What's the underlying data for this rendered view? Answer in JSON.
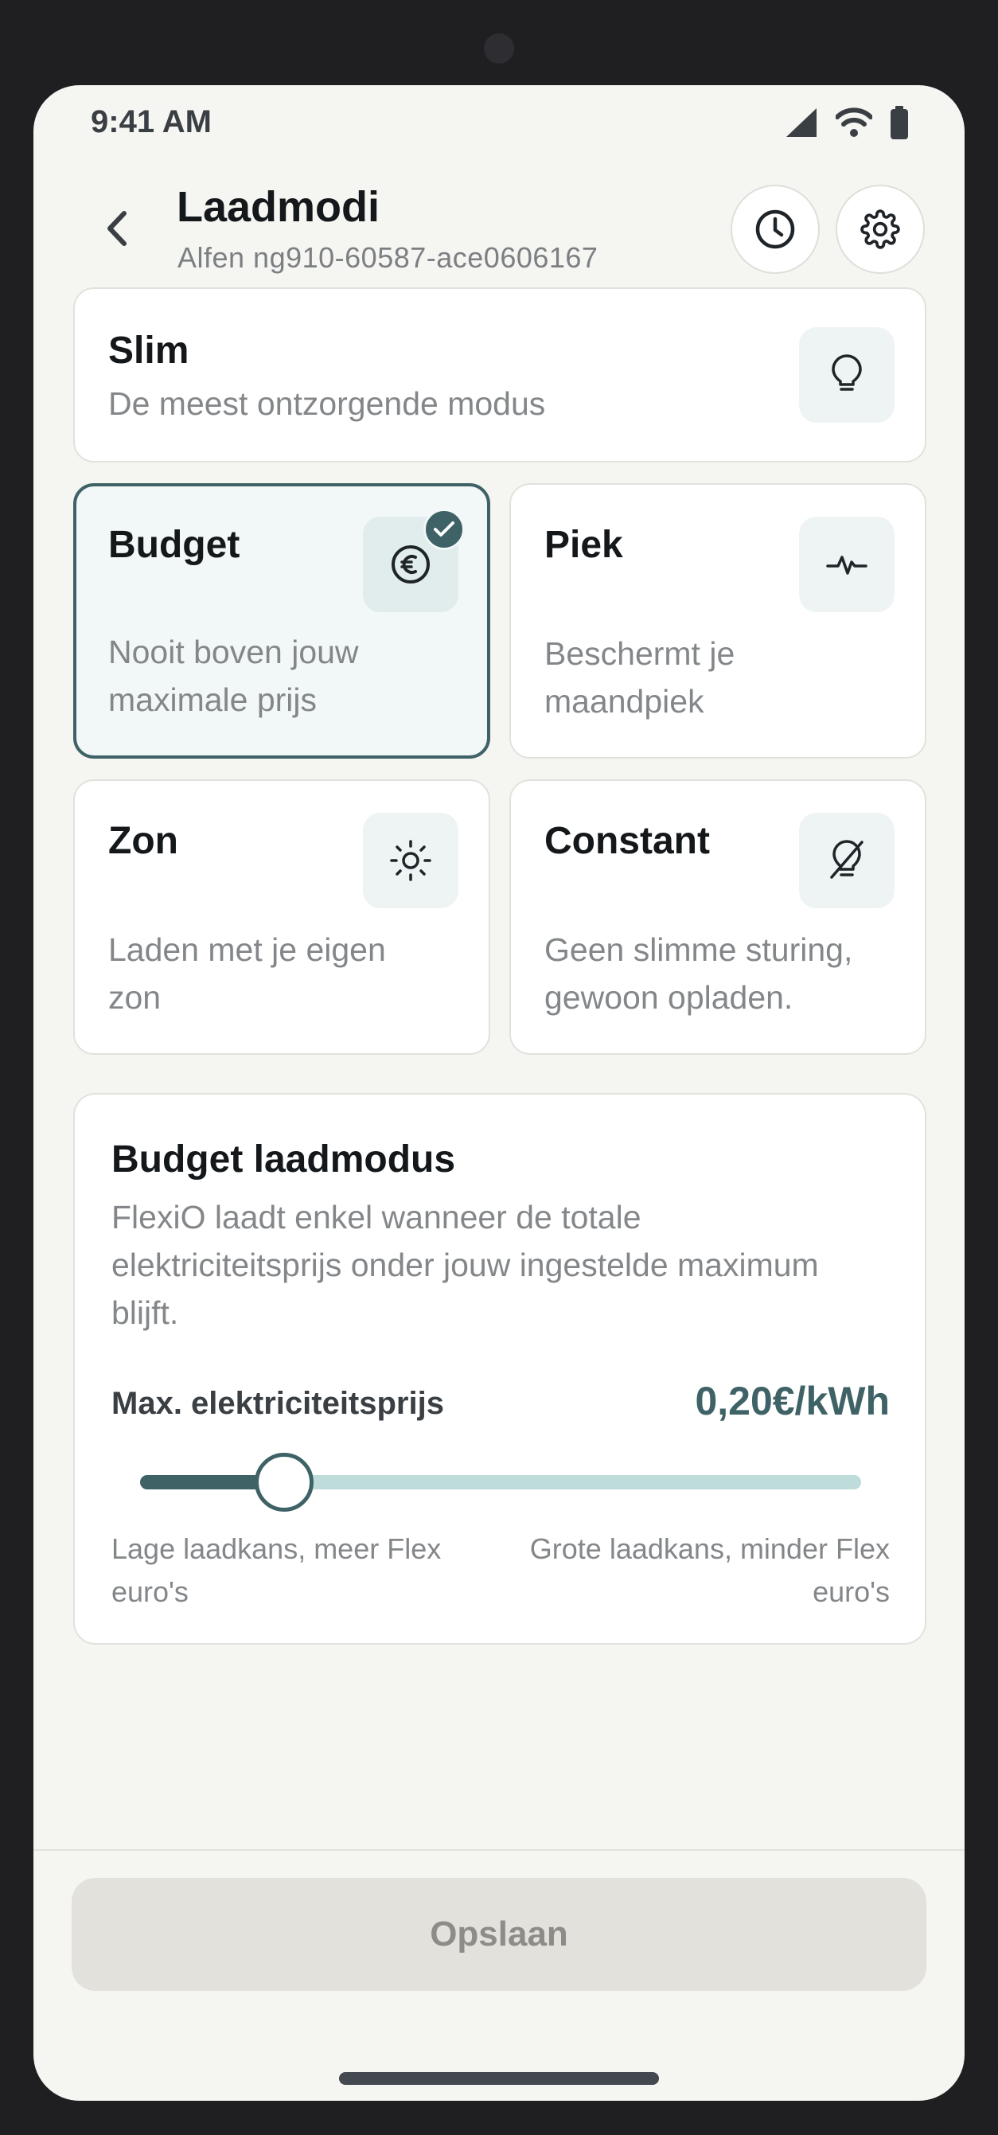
{
  "status_bar": {
    "time": "9:41 AM"
  },
  "header": {
    "title": "Laadmodi",
    "subtitle": "Alfen ng910-60587-ace0606167"
  },
  "modes": {
    "slim": {
      "title": "Slim",
      "description": "De meest ontzorgende modus",
      "icon": "lightbulb-icon",
      "selected": false
    },
    "budget": {
      "title": "Budget",
      "description_line1": "Nooit boven jouw",
      "description_line2": "maximale prijs",
      "icon": "euro-icon",
      "selected": true
    },
    "piek": {
      "title": "Piek",
      "description_line1": "Beschermt je",
      "description_line2": "maandpiek",
      "icon": "pulse-icon",
      "selected": false
    },
    "zon": {
      "title": "Zon",
      "description_line1": "Laden met je eigen",
      "description_line2": "zon",
      "icon": "sun-icon",
      "selected": false
    },
    "constant": {
      "title": "Constant",
      "description_line1": "Geen slimme sturing,",
      "description_line2": "gewoon opladen.",
      "icon": "lightbulb-off-icon",
      "selected": false
    }
  },
  "budget_panel": {
    "title": "Budget laadmodus",
    "description": "FlexiO laadt enkel wanneer de totale elektriciteitsprijs onder jouw ingestelde maximum blijft.",
    "price_label": "Max. elektriciteitsprijs",
    "price_value": "0,20€/kWh",
    "slider_fraction": 0.2,
    "hint_left": "Lage laadkans, meer Flex euro's",
    "hint_right": "Grote laadkans, minder Flex euro's"
  },
  "footer": {
    "save_label": "Opslaan",
    "save_enabled": false
  },
  "colors": {
    "accent": "#3e6266",
    "track": "#bedcda",
    "background": "#f5f5f2",
    "disabled_button": "#e3e1db"
  }
}
